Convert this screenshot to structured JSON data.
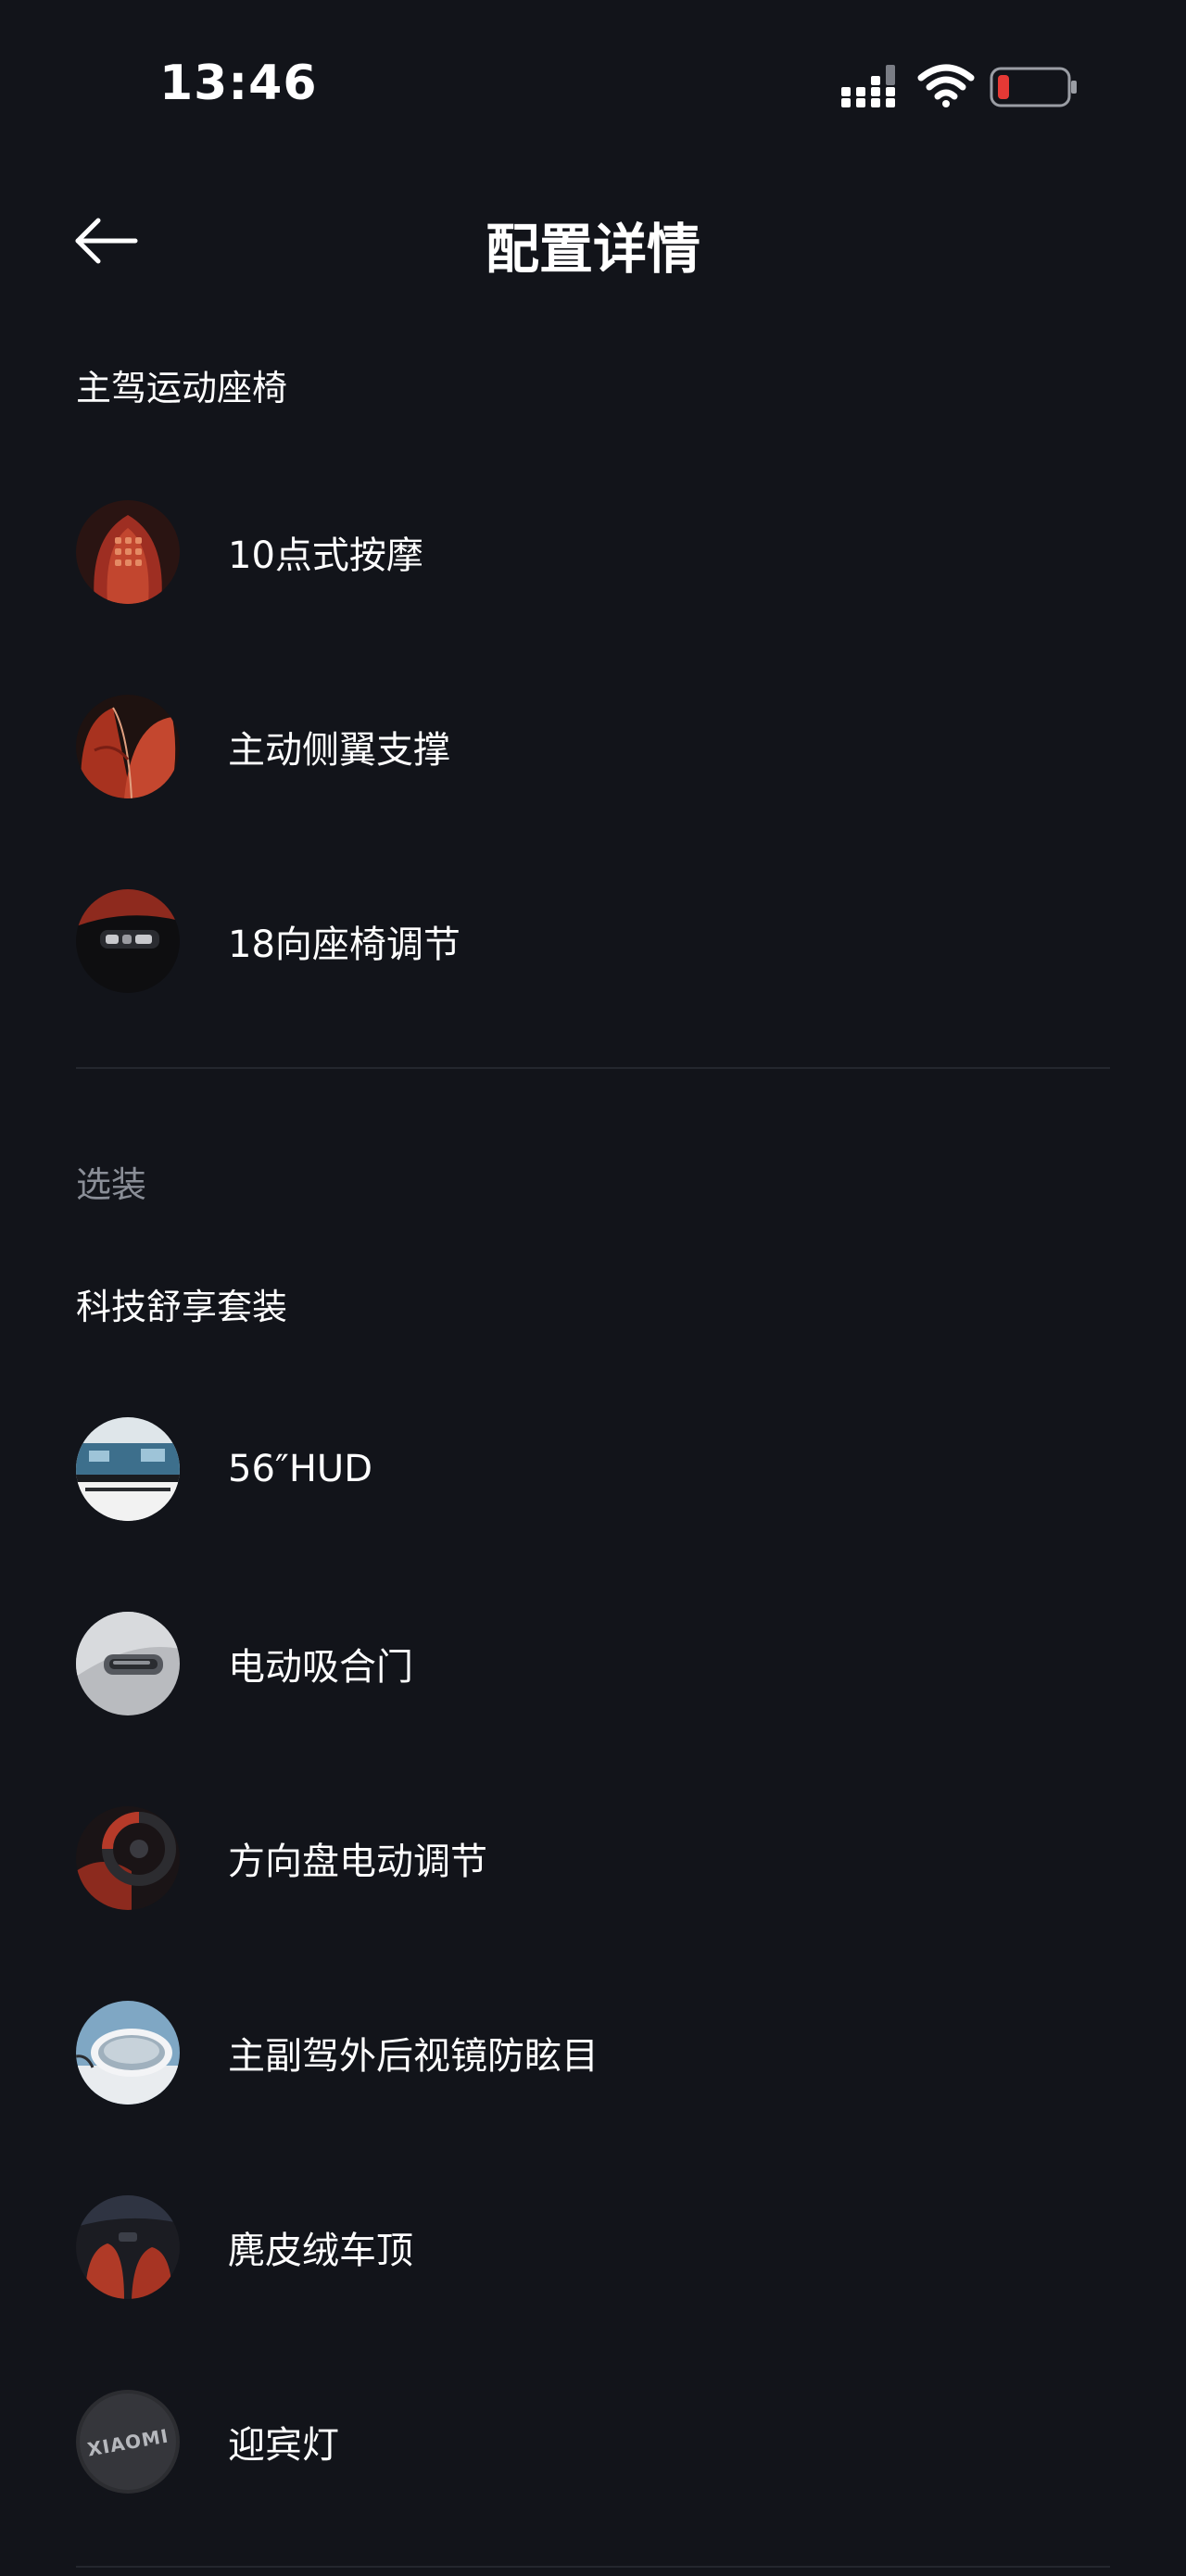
{
  "status_bar": {
    "time": "13:46",
    "signal_icon": "cellular-signal-icon",
    "wifi_icon": "wifi-icon",
    "battery_icon": "battery-low-icon",
    "battery_color": "#e53935"
  },
  "header": {
    "back_icon": "arrow-left-icon",
    "title": "配置详情"
  },
  "section_seat": {
    "title": "主驾运动座椅",
    "items": [
      {
        "label": "10点式按摩"
      },
      {
        "label": "主动侧翼支撑"
      },
      {
        "label": "18向座椅调节"
      }
    ]
  },
  "section_optional": {
    "label": "选装",
    "package_title": "科技舒享套装",
    "items": [
      {
        "label": "56″HUD"
      },
      {
        "label": "电动吸合门"
      },
      {
        "label": "方向盘电动调节"
      },
      {
        "label": "主副驾外后视镜防眩目"
      },
      {
        "label": "麂皮绒车顶"
      },
      {
        "label": "迎宾灯"
      }
    ]
  },
  "logo_text": "XIAOMI",
  "colors": {
    "background": "#12141a",
    "text_primary": "#ffffff",
    "text_secondary": "#8a8e97",
    "divider": "#24272e",
    "seat_red": "#b8392b"
  }
}
